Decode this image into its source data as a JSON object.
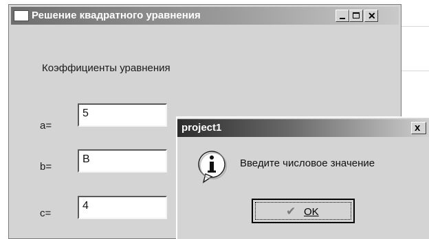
{
  "main_window": {
    "title": "Решение квадратного уравнения",
    "coefficients_label": "Коэффициенты уравнения",
    "fields": [
      {
        "label": "a=",
        "value": "5"
      },
      {
        "label": "b=",
        "value": "В"
      },
      {
        "label": "c=",
        "value": "4"
      }
    ]
  },
  "dialog": {
    "title": "project1",
    "close_symbol": "x",
    "message": "Введите числовое значение",
    "icon": "information-icon",
    "ok_label": "OK"
  },
  "icons": {
    "minimize": "minimize-icon",
    "maximize": "maximize-icon",
    "close": "close-icon",
    "ok_check": "checkmark-icon"
  }
}
